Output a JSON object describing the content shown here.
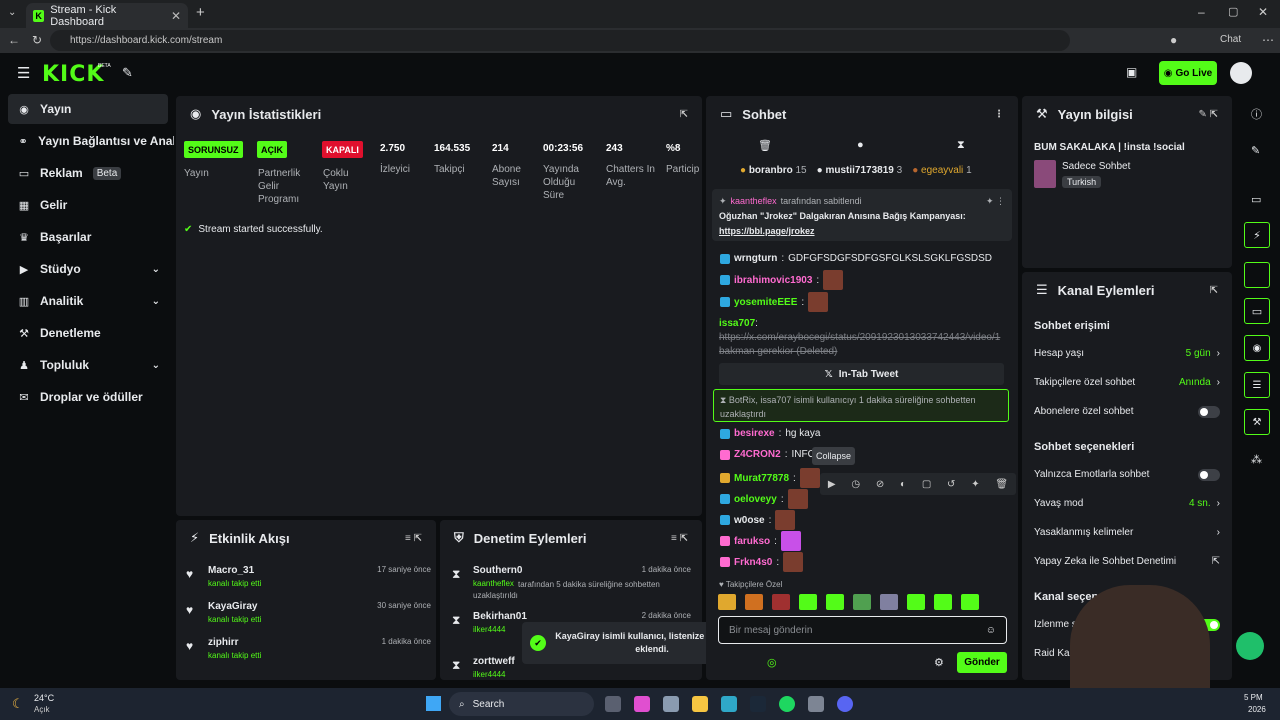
{
  "browser": {
    "tab_title": "Stream - Kick Dashboard",
    "url": "https://dashboard.kick.com/stream",
    "chat_label": "Chat"
  },
  "topbar": {
    "logo": "KICK",
    "logo_sup": "BETA",
    "go_live": "Go Live"
  },
  "sidebar": {
    "items": [
      {
        "label": "Yayın",
        "icon": "play"
      },
      {
        "label": "Yayın Bağlantısı ve Anahtarı",
        "icon": "link"
      },
      {
        "label": "Reklam",
        "badge": "Beta"
      },
      {
        "label": "Gelir"
      },
      {
        "label": "Başarılar"
      },
      {
        "label": "Stüdyo"
      },
      {
        "label": "Analitik"
      },
      {
        "label": "Denetleme"
      },
      {
        "label": "Topluluk"
      },
      {
        "label": "Droplar ve ödüller"
      }
    ]
  },
  "stats": {
    "title": "Yayın İstatistikleri",
    "cols": [
      {
        "pill": "SORUNSUZ",
        "label": "Yayın"
      },
      {
        "pill": "AÇIK",
        "label": "Partnerlik Gelir Programı"
      },
      {
        "pill": "KAPALI",
        "label": "Çoklu Yayın"
      },
      {
        "value": "2.750",
        "label": "İzleyici"
      },
      {
        "value": "164.535",
        "label": "Takipçi"
      },
      {
        "value": "214",
        "label": "Abone Sayısı"
      },
      {
        "value": "00:23:56",
        "label": "Yayında Olduğu Süre"
      },
      {
        "value": "243",
        "label": "Chatters In Avg."
      },
      {
        "value": "%8",
        "label": "Particip"
      }
    ],
    "success": "Stream started successfully."
  },
  "activity": {
    "title": "Etkinlik Akışı",
    "items": [
      {
        "user": "Macro_31",
        "action": "kanalı takip etti",
        "time": "17 saniye önce"
      },
      {
        "user": "KayaGiray",
        "action": "kanalı takip etti",
        "time": "30 saniye önce"
      },
      {
        "user": "ziphirr",
        "action": "kanalı takip etti",
        "time": "1 dakika önce"
      }
    ]
  },
  "moderation": {
    "title": "Denetim Eylemleri",
    "items": [
      {
        "user": "Southern0",
        "by": "kaantheflex",
        "desc": "tarafından 5 dakika süreliğine sohbetten uzaklaştırıldı",
        "time": "1 dakika önce"
      },
      {
        "user": "Bekirhan01",
        "by": "ilker4444",
        "desc": "tarafından 5 dakika süreliğine sohbetten uzaklaştırıldı",
        "time": "2 dakika önce"
      },
      {
        "user": "zorttweff",
        "by": "ilker4444",
        "desc": "tarafından 5 dakika süreliğine sohbetten uzaklaştırıldı",
        "time": ""
      }
    ],
    "toast": "KayaGiray isimli kullanıcı, listenize vip olarak eklendi."
  },
  "chat": {
    "title": "Sohbet",
    "top_gifters": [
      {
        "name": "boranbro",
        "count": "15"
      },
      {
        "name": "mustii7173819",
        "count": "3"
      },
      {
        "name": "egeayvali",
        "count": "1"
      }
    ],
    "pinned_by": "tarafından sabitlendi",
    "pinned_msg": "Oğuzhan \"Jrokez\" Dalgakıran Anısına Bağış Kampanyası:",
    "pinned_link": "https://bbl.page/jrokez",
    "messages": [
      {
        "user": "wrngturn",
        "text": "GDFGFSDGFSDFGSFGLKSLSGKLFGSDSD",
        "color": "#e8eaed"
      },
      {
        "user": "ibrahimovic1903",
        "text": "",
        "color": "#ff6bd0"
      },
      {
        "user": "yosemiteEEE",
        "text": "",
        "color": "#53fc18"
      },
      {
        "user": "issa707",
        "text": "https://x.com/eraybocegi/status/2091923013033742443/video/1 bakman gerekior (Deleted)",
        "color": "#53fc18"
      }
    ],
    "in_tab": "In-Tab Tweet",
    "bot_msg": "BotRix, issa707 isimli kullanıcıyı 1 dakika süreliğine sohbetten uzaklaştırdı",
    "messages2": [
      {
        "user": "besirexe",
        "text": "hg kaya",
        "color": "#ff6bd0"
      },
      {
        "user": "Z4CRON2",
        "text": "INFO",
        "color": "#ff6bd0"
      },
      {
        "user": "Murat77878",
        "text": "",
        "color": "#53fc18"
      },
      {
        "user": "oeloveyy",
        "text": "",
        "color": "#53fc18"
      },
      {
        "user": "w0ose",
        "text": "",
        "color": "#e8eaed"
      },
      {
        "user": "farukso",
        "text": "",
        "color": "#ff6bd0"
      },
      {
        "user": "Frkn4s0",
        "text": "",
        "color": "#ff6bd0"
      }
    ],
    "tooltip": "Collapse",
    "followers_only": "Takipçilere Özel",
    "input_placeholder": "Bir mesaj gönderin",
    "send": "Gönder"
  },
  "info": {
    "title": "Yayın bilgisi",
    "stream_title": "BUM SAKALAKA | !insta !social",
    "category": "Sadece Sohbet",
    "tag": "Turkish"
  },
  "channel": {
    "title": "Kanal Eylemleri",
    "access_title": "Sohbet erişimi",
    "rows": [
      {
        "label": "Hesap yaşı",
        "value": "5 gün"
      },
      {
        "label": "Takipçilere özel sohbet",
        "value": "Anında"
      },
      {
        "label": "Abonelere özel sohbet",
        "value": ""
      }
    ],
    "options_title": "Sohbet seçenekleri",
    "rows2": [
      {
        "label": "Yalnızca Emotlarla sohbet",
        "value": ""
      },
      {
        "label": "Yavaş mod",
        "value": "4 sn."
      },
      {
        "label": "Yasaklanmış kelimeler",
        "value": ""
      },
      {
        "label": "Yapay Zeka ile Sohbet Denetimi",
        "value": ""
      }
    ],
    "channel_opts_title": "Kanal seçenekleri",
    "rows3": [
      {
        "label": "İzlenme sayısını göster"
      },
      {
        "label": "Raid Kanalı"
      }
    ]
  },
  "taskbar": {
    "weather_temp": "24°C",
    "weather_desc": "Açık",
    "search": "Search",
    "time": "5 PM",
    "date": "2026"
  }
}
